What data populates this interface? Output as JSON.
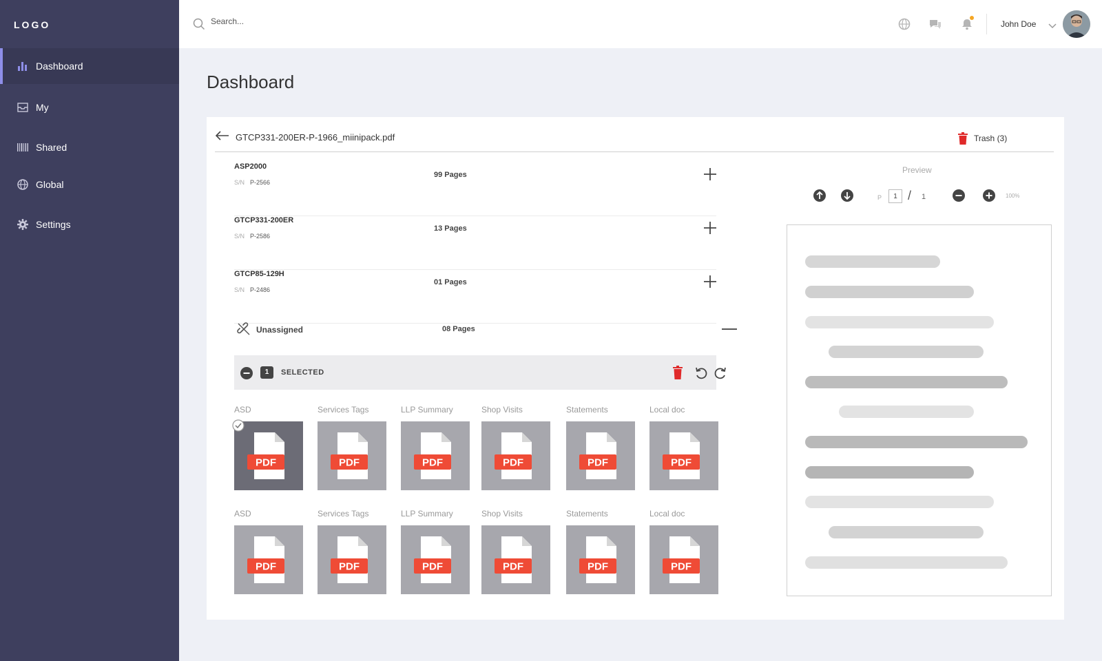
{
  "app": {
    "logo": "LOGO"
  },
  "sidebar": {
    "items": [
      {
        "label": "Dashboard",
        "icon": "bar-chart-icon",
        "active": true
      },
      {
        "label": "My",
        "icon": "inbox-icon",
        "active": false
      },
      {
        "label": "Shared",
        "icon": "barcode-icon",
        "active": false
      },
      {
        "label": "Global",
        "icon": "globe-icon",
        "active": false
      },
      {
        "label": "Settings",
        "icon": "gear-icon",
        "active": false
      }
    ]
  },
  "header": {
    "search_placeholder": "Search...",
    "user_name": "John Doe",
    "icons": [
      "globe-icon",
      "chat-icon",
      "bell-icon"
    ],
    "notification_dot_color": "#f5a623"
  },
  "page": {
    "title": "Dashboard"
  },
  "document": {
    "file_name": "GTCP331-200ER-P-1966_miinipack.pdf",
    "trash_label": "Trash (3)",
    "rows": [
      {
        "name": "ASP2000",
        "sn_label": "S/N",
        "sn": "P-2566",
        "pages": "99 Pages"
      },
      {
        "name": "GTCP331-200ER",
        "sn_label": "S/N",
        "sn": "P-2586",
        "pages": "13 Pages"
      },
      {
        "name": "GTCP85-129H",
        "sn_label": "S/N",
        "sn": "P-2486",
        "pages": "01 Pages"
      }
    ],
    "unassigned": {
      "label": "Unassigned",
      "pages": "08 Pages"
    },
    "selection": {
      "count": "1",
      "label": "SELECTED"
    },
    "thumbnails_row1": [
      {
        "label": "ASD",
        "badge": "PDF",
        "selected": true
      },
      {
        "label": "Services Tags",
        "badge": "PDF",
        "selected": false
      },
      {
        "label": "LLP Summary",
        "badge": "PDF",
        "selected": false
      },
      {
        "label": "Shop Visits",
        "badge": "PDF",
        "selected": false
      },
      {
        "label": "Statements",
        "badge": "PDF",
        "selected": false
      },
      {
        "label": "Local doc",
        "badge": "PDF",
        "selected": false
      }
    ],
    "thumbnails_row2": [
      {
        "label": "ASD",
        "badge": "PDF",
        "selected": false
      },
      {
        "label": "Services Tags",
        "badge": "PDF",
        "selected": false
      },
      {
        "label": "LLP Summary",
        "badge": "PDF",
        "selected": false
      },
      {
        "label": "Shop Visits",
        "badge": "PDF",
        "selected": false
      },
      {
        "label": "Statements",
        "badge": "PDF",
        "selected": false
      },
      {
        "label": "Local doc",
        "badge": "PDF",
        "selected": false
      }
    ]
  },
  "preview": {
    "label": "Preview",
    "page_prefix": "P",
    "current_page": "1",
    "separator": "/",
    "total_pages": "1",
    "zoom": "100%"
  },
  "colors": {
    "sidebar_bg": "#3e3f5e",
    "accent": "#8e8ee8",
    "pdf_badge": "#ef4b36",
    "trash_red": "#e02a2a"
  }
}
